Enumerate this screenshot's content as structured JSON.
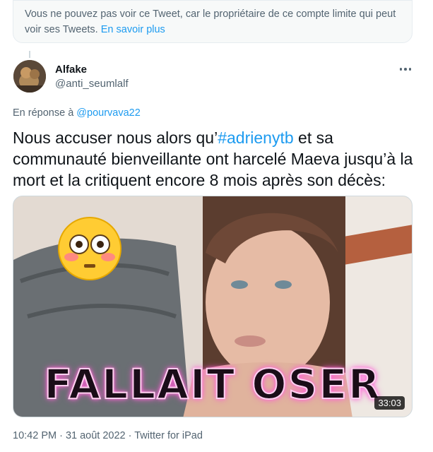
{
  "notice": {
    "text": "Vous ne pouvez pas voir ce Tweet, car le propriétaire de ce compte limite qui peut voir ses Tweets.",
    "link": "En savoir plus"
  },
  "author": {
    "name": "Alfake",
    "handle": "@anti_seumlalf"
  },
  "reply": {
    "prefix": "En réponse à",
    "mention": "@pourvava22"
  },
  "tweet": {
    "text_before": "Nous accuser nous alors qu’",
    "hashtag": "#adrienytb",
    "text_after": " et sa communauté bienveillante ont harcelé Maeva jusqu’à la mort et la critiquent encore 8 mois après son décès:"
  },
  "media": {
    "overlay": "FALLAIT OSER",
    "duration": "33:03",
    "emoji": "flushed-face"
  },
  "meta": {
    "timestamp": "10:42 PM · 31 août 2022 · Twitter for iPad"
  }
}
